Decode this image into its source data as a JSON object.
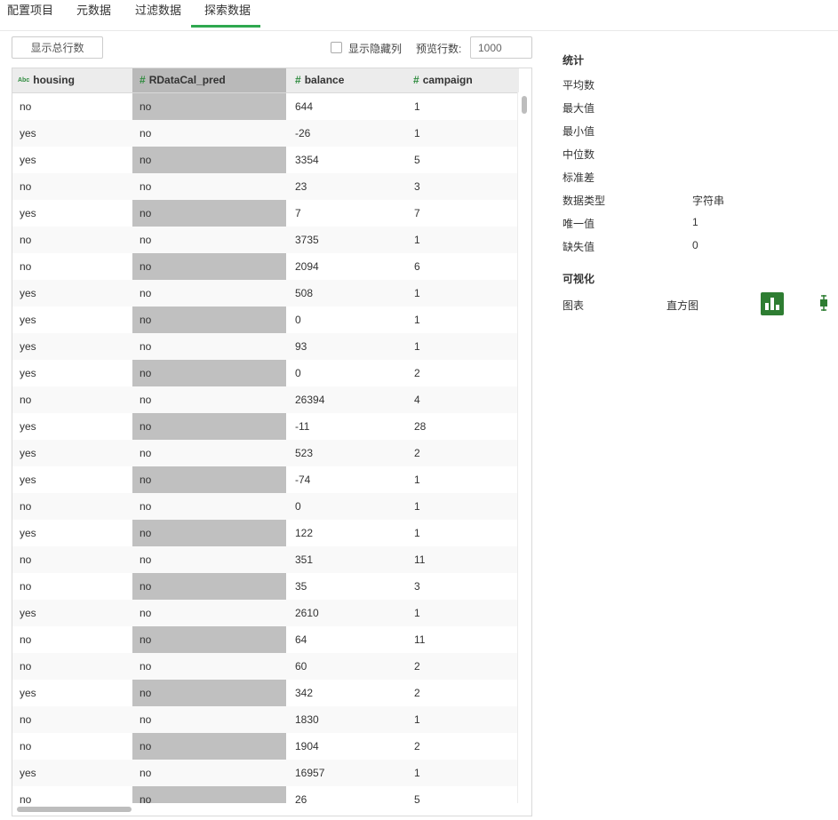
{
  "tabs": [
    "配置项目",
    "元数据",
    "过滤数据",
    "探索数据"
  ],
  "toolbar": {
    "show_total_label": "显示总行数",
    "show_hidden_label": "显示隐藏列",
    "preview_rows_label": "预览行数:",
    "preview_rows_value": "1000"
  },
  "columns": [
    {
      "name": "housing",
      "type_icon": "Abc"
    },
    {
      "name": "RDataCal_pred",
      "type_icon": "#"
    },
    {
      "name": "balance",
      "type_icon": "#"
    },
    {
      "name": "campaign",
      "type_icon": "#"
    }
  ],
  "rows": [
    [
      "no",
      "no",
      "644",
      "1"
    ],
    [
      "yes",
      "no",
      "-26",
      "1"
    ],
    [
      "yes",
      "no",
      "3354",
      "5"
    ],
    [
      "no",
      "no",
      "23",
      "3"
    ],
    [
      "yes",
      "no",
      "7",
      "7"
    ],
    [
      "no",
      "no",
      "3735",
      "1"
    ],
    [
      "no",
      "no",
      "2094",
      "6"
    ],
    [
      "yes",
      "no",
      "508",
      "1"
    ],
    [
      "yes",
      "no",
      "0",
      "1"
    ],
    [
      "yes",
      "no",
      "93",
      "1"
    ],
    [
      "yes",
      "no",
      "0",
      "2"
    ],
    [
      "no",
      "no",
      "26394",
      "4"
    ],
    [
      "yes",
      "no",
      "-11",
      "28"
    ],
    [
      "yes",
      "no",
      "523",
      "2"
    ],
    [
      "yes",
      "no",
      "-74",
      "1"
    ],
    [
      "no",
      "no",
      "0",
      "1"
    ],
    [
      "yes",
      "no",
      "122",
      "1"
    ],
    [
      "no",
      "no",
      "351",
      "11"
    ],
    [
      "no",
      "no",
      "35",
      "3"
    ],
    [
      "yes",
      "no",
      "2610",
      "1"
    ],
    [
      "no",
      "no",
      "64",
      "11"
    ],
    [
      "no",
      "no",
      "60",
      "2"
    ],
    [
      "yes",
      "no",
      "342",
      "2"
    ],
    [
      "no",
      "no",
      "1830",
      "1"
    ],
    [
      "no",
      "no",
      "1904",
      "2"
    ],
    [
      "yes",
      "no",
      "16957",
      "1"
    ],
    [
      "no",
      "no",
      "26",
      "5"
    ]
  ],
  "stats": {
    "title": "统计",
    "items": [
      {
        "key": "平均数",
        "value": ""
      },
      {
        "key": "最大值",
        "value": ""
      },
      {
        "key": "最小值",
        "value": ""
      },
      {
        "key": "中位数",
        "value": ""
      },
      {
        "key": "标准差",
        "value": ""
      },
      {
        "key": "数据类型",
        "value": "字符串"
      },
      {
        "key": "唯一值",
        "value": "1"
      },
      {
        "key": "缺失值",
        "value": "0"
      }
    ],
    "viz_title": "可视化",
    "chart_label": "图表",
    "chart_type": "直方图",
    "icons": [
      "histogram-icon",
      "boxplot-icon"
    ],
    "accent_color": "#2e7d32"
  }
}
